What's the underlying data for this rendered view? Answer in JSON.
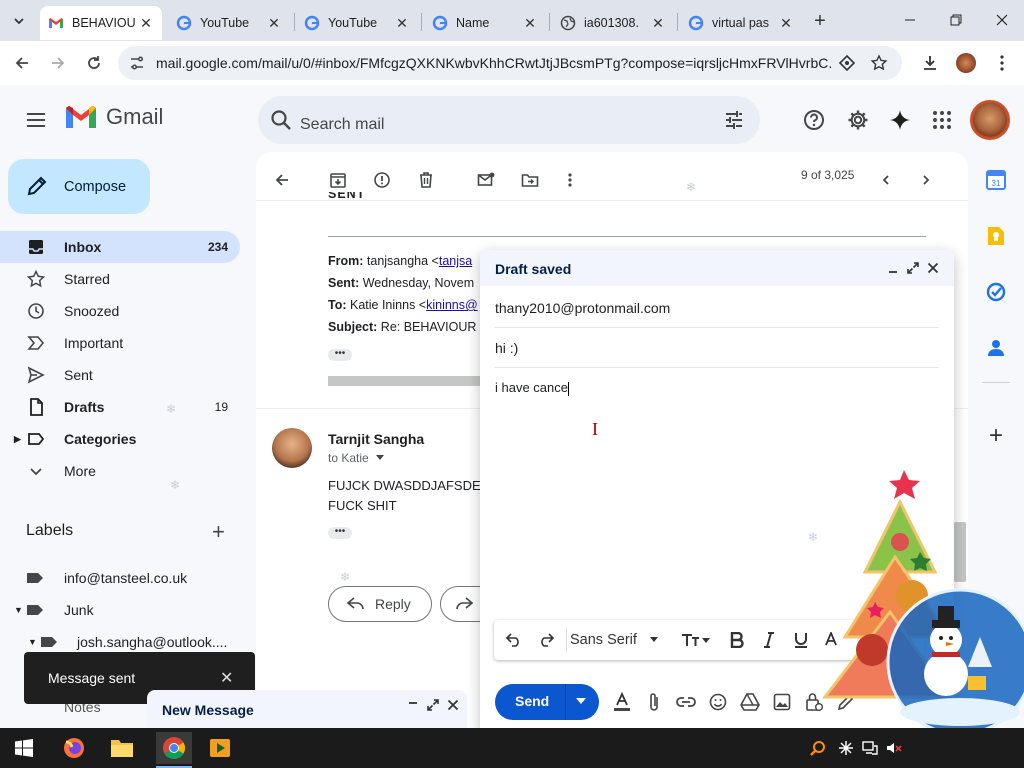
{
  "browser": {
    "tabs": [
      {
        "title": "BEHAVIOU",
        "favicon": "gmail-icon",
        "active": true
      },
      {
        "title": "YouTube",
        "favicon": "google-icon",
        "active": false
      },
      {
        "title": "YouTube",
        "favicon": "google-icon",
        "active": false
      },
      {
        "title": "Name",
        "favicon": "google-icon",
        "active": false
      },
      {
        "title": "ia601308.",
        "favicon": "globe-icon",
        "active": false
      },
      {
        "title": "virtual pas",
        "favicon": "google-icon",
        "active": false
      }
    ],
    "url": "mail.google.com/mail/u/0/#inbox/FMfcgzQXKNKwbvKhhCRwtJtjJBcsmPTg?compose=iqrsljcHmxFRVlHvrbC..."
  },
  "gmail": {
    "brand": "Gmail",
    "search_placeholder": "Search mail",
    "compose_label": "Compose",
    "nav": [
      {
        "label": "Inbox",
        "count": "234",
        "icon": "inbox-icon",
        "selected": true
      },
      {
        "label": "Starred",
        "count": "",
        "icon": "star-icon"
      },
      {
        "label": "Snoozed",
        "count": "",
        "icon": "clock-icon"
      },
      {
        "label": "Important",
        "count": "",
        "icon": "important-icon"
      },
      {
        "label": "Sent",
        "count": "",
        "icon": "send-icon"
      },
      {
        "label": "Drafts",
        "count": "19",
        "icon": "draft-icon"
      },
      {
        "label": "Categories",
        "count": "",
        "icon": "label-icon"
      },
      {
        "label": "More",
        "count": "",
        "icon": "chevron-down-icon"
      }
    ],
    "labels_heading": "Labels",
    "labels": [
      "info@tansteel.co.uk",
      "Junk",
      "josh.sangha@outlook...."
    ],
    "partial_label": "Notes"
  },
  "message": {
    "pager": "9 of 3,025",
    "quoted_top": "SENT",
    "quoted": {
      "from_label": "From:",
      "from_value": "tanjsangha <",
      "from_link": "tanjsa",
      "sent_label": "Sent:",
      "sent_value": "Wednesday, Novem",
      "to_label": "To:",
      "to_value": "Katie Ininns <",
      "to_link": "kininns@",
      "subject_label": "Subject:",
      "subject_value": "Re: BEHAVIOUR I"
    },
    "sender_name": "Tarnjit Sangha",
    "to_line": "to Katie",
    "body_line1": "FUJCK DWASDDJAFSDE",
    "body_line2": "FUCK SHIT",
    "reply_label": "Reply"
  },
  "draft": {
    "header": "Draft saved",
    "to": "thany2010@protonmail.com",
    "subject": "hi :)",
    "body": "i have cance",
    "font": "Sans Serif",
    "send_label": "Send"
  },
  "toast": {
    "text": "Message sent"
  },
  "minimized_draft": {
    "title": "New Message"
  }
}
